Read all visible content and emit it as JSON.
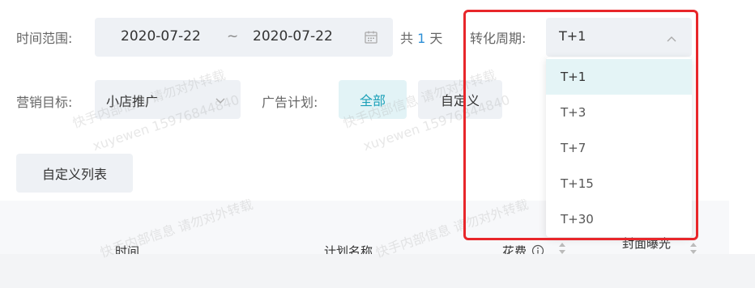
{
  "filters": {
    "time_range_label": "时间范围:",
    "start_date": "2020-07-22",
    "separator": "~",
    "end_date": "2020-07-22",
    "total_prefix": "共",
    "total_days": "1",
    "total_suffix": "天",
    "conversion_period_label": "转化周期:",
    "conversion_period_value": "T+1",
    "marketing_goal_label": "营销目标:",
    "marketing_goal_value": "小店推广",
    "ad_plan_label": "广告计划:",
    "ad_plan_all": "全部",
    "ad_plan_custom": "自定义"
  },
  "custom_list_button": "自定义列表",
  "table_headers": {
    "time": "时间",
    "plan_name": "计划名称",
    "spend": "花费",
    "cover_exposure": "封面曝光"
  },
  "dropdown": {
    "options": [
      "T+1",
      "T+3",
      "T+7",
      "T+15",
      "T+30"
    ],
    "selected": "T+1"
  },
  "watermark": {
    "text_a": "快手内部信息 请勿对外转载",
    "text_b": "xuyewen 15976844840"
  },
  "colors": {
    "accent": "#1aa0b8",
    "link": "#2d8fd6",
    "highlight": "#e8262a"
  }
}
